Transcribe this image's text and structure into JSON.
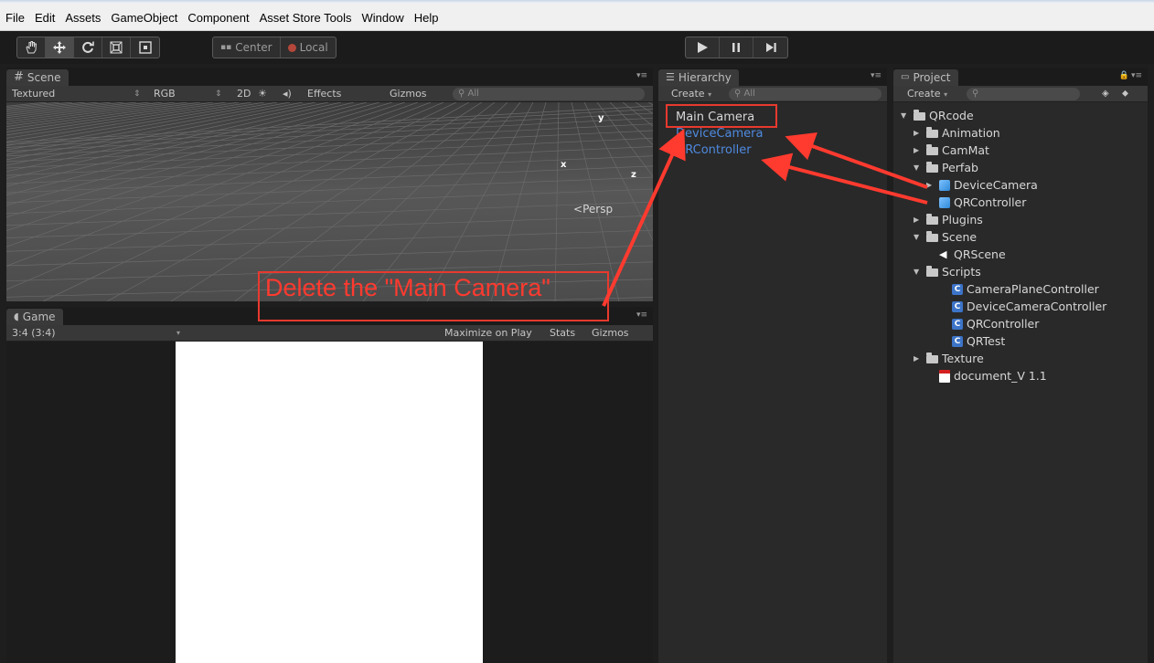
{
  "menu": [
    "File",
    "Edit",
    "Assets",
    "GameObject",
    "Component",
    "Asset Store Tools",
    "Window",
    "Help"
  ],
  "toolbar": {
    "tools": [
      "hand-icon",
      "move-icon",
      "rotate-icon",
      "scale-icon",
      "rect-icon"
    ],
    "pivot_center": "Center",
    "pivot_local": "Local",
    "playback": [
      "play-icon",
      "pause-icon",
      "step-icon"
    ]
  },
  "scene": {
    "tab_label": "Scene",
    "shading": "Textured",
    "render_mode": "RGB",
    "mode_2d": "2D",
    "effects": "Effects",
    "gizmos": "Gizmos",
    "search_placeholder": "All",
    "axis_y": "y",
    "axis_x": "x",
    "axis_z": "z",
    "persp": "Persp"
  },
  "game": {
    "tab_label": "Game",
    "aspect": "3:4 (3:4)",
    "maximize": "Maximize on Play",
    "stats": "Stats",
    "gizmos": "Gizmos"
  },
  "hierarchy": {
    "tab_label": "Hierarchy",
    "create": "Create",
    "search_placeholder": "All",
    "items": [
      {
        "label": "Main Camera",
        "prefab": false
      },
      {
        "label": "DeviceCamera",
        "prefab": true
      },
      {
        "label": "QRController",
        "prefab": true
      }
    ]
  },
  "project": {
    "tab_label": "Project",
    "create": "Create",
    "tree": [
      {
        "label": "QRcode",
        "icon": "folder",
        "fold": "open",
        "indent": 0
      },
      {
        "label": "Animation",
        "icon": "folder",
        "fold": "closed",
        "indent": 1
      },
      {
        "label": "CamMat",
        "icon": "folder",
        "fold": "closed",
        "indent": 1
      },
      {
        "label": "Perfab",
        "icon": "folder",
        "fold": "open",
        "indent": 1
      },
      {
        "label": "DeviceCamera",
        "icon": "prefab",
        "fold": "closed",
        "indent": 2
      },
      {
        "label": "QRController",
        "icon": "prefab",
        "fold": "none",
        "indent": 2
      },
      {
        "label": "Plugins",
        "icon": "folder",
        "fold": "closed",
        "indent": 1
      },
      {
        "label": "Scene",
        "icon": "folder",
        "fold": "open",
        "indent": 1
      },
      {
        "label": "QRScene",
        "icon": "unity-scene",
        "fold": "none",
        "indent": 2
      },
      {
        "label": "Scripts",
        "icon": "folder",
        "fold": "open",
        "indent": 1
      },
      {
        "label": "CameraPlaneController",
        "icon": "csharp",
        "fold": "none",
        "indent": 3
      },
      {
        "label": "DeviceCameraController",
        "icon": "csharp",
        "fold": "none",
        "indent": 3
      },
      {
        "label": "QRController",
        "icon": "csharp",
        "fold": "none",
        "indent": 3
      },
      {
        "label": "QRTest",
        "icon": "csharp",
        "fold": "none",
        "indent": 3
      },
      {
        "label": "Texture",
        "icon": "folder",
        "fold": "closed",
        "indent": 1
      },
      {
        "label": "document_V 1.1",
        "icon": "pdf",
        "fold": "none",
        "indent": 2
      }
    ]
  },
  "annotation": {
    "text": "Delete the \"Main Camera\"",
    "color": "#e8392e"
  }
}
